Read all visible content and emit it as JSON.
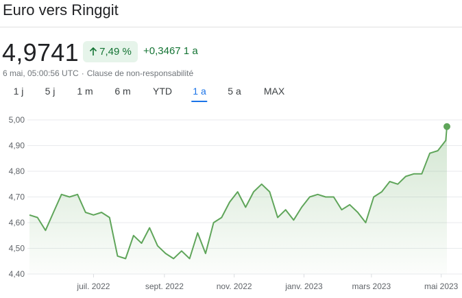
{
  "header": {
    "title": "Euro vers Ringgit"
  },
  "quote": {
    "price": "4,9741",
    "percent": "7,49 %",
    "change": "+0,3467 1 a",
    "timestamp": "6 mai, 05:00:56 UTC",
    "separator": "·",
    "disclaimer": "Clause de non-responsabilité"
  },
  "colors": {
    "up": "#137333",
    "line": "#5fa55a",
    "accent": "#1a73e8"
  },
  "tabs": [
    {
      "label": "1 j"
    },
    {
      "label": "5 j"
    },
    {
      "label": "1 m"
    },
    {
      "label": "6 m"
    },
    {
      "label": "YTD"
    },
    {
      "label": "1 a",
      "active": true
    },
    {
      "label": "5 a"
    },
    {
      "label": "MAX"
    }
  ],
  "chart_data": {
    "type": "area",
    "ylim": [
      4.4,
      5.0
    ],
    "yticks": [
      "5,00",
      "4,90",
      "4,80",
      "4,70",
      "4,60",
      "4,50",
      "4,40"
    ],
    "xticks": [
      "juil. 2022",
      "sept. 2022",
      "nov. 2022",
      "janv. 2023",
      "mars 2023",
      "mai 2023"
    ],
    "x": [
      "2022-05-06",
      "2022-05-13",
      "2022-05-20",
      "2022-05-27",
      "2022-06-03",
      "2022-06-10",
      "2022-06-17",
      "2022-06-24",
      "2022-07-01",
      "2022-07-08",
      "2022-07-15",
      "2022-07-22",
      "2022-07-29",
      "2022-08-05",
      "2022-08-12",
      "2022-08-19",
      "2022-08-26",
      "2022-09-02",
      "2022-09-09",
      "2022-09-16",
      "2022-09-23",
      "2022-09-30",
      "2022-10-07",
      "2022-10-14",
      "2022-10-21",
      "2022-10-28",
      "2022-11-04",
      "2022-11-11",
      "2022-11-18",
      "2022-11-25",
      "2022-12-02",
      "2022-12-09",
      "2022-12-16",
      "2022-12-23",
      "2022-12-30",
      "2023-01-06",
      "2023-01-13",
      "2023-01-20",
      "2023-01-27",
      "2023-02-03",
      "2023-02-10",
      "2023-02-17",
      "2023-02-24",
      "2023-03-03",
      "2023-03-10",
      "2023-03-17",
      "2023-03-24",
      "2023-03-31",
      "2023-04-07",
      "2023-04-14",
      "2023-04-21",
      "2023-04-28",
      "2023-05-05",
      "2023-05-06"
    ],
    "values": [
      4.63,
      4.62,
      4.57,
      4.64,
      4.71,
      4.7,
      4.71,
      4.64,
      4.63,
      4.64,
      4.62,
      4.47,
      4.46,
      4.55,
      4.52,
      4.58,
      4.51,
      4.48,
      4.46,
      4.49,
      4.46,
      4.56,
      4.48,
      4.6,
      4.62,
      4.68,
      4.72,
      4.66,
      4.72,
      4.75,
      4.72,
      4.62,
      4.65,
      4.61,
      4.66,
      4.7,
      4.71,
      4.7,
      4.7,
      4.65,
      4.67,
      4.64,
      4.6,
      4.7,
      4.72,
      4.76,
      4.75,
      4.78,
      4.79,
      4.79,
      4.87,
      4.88,
      4.92,
      4.974
    ]
  }
}
